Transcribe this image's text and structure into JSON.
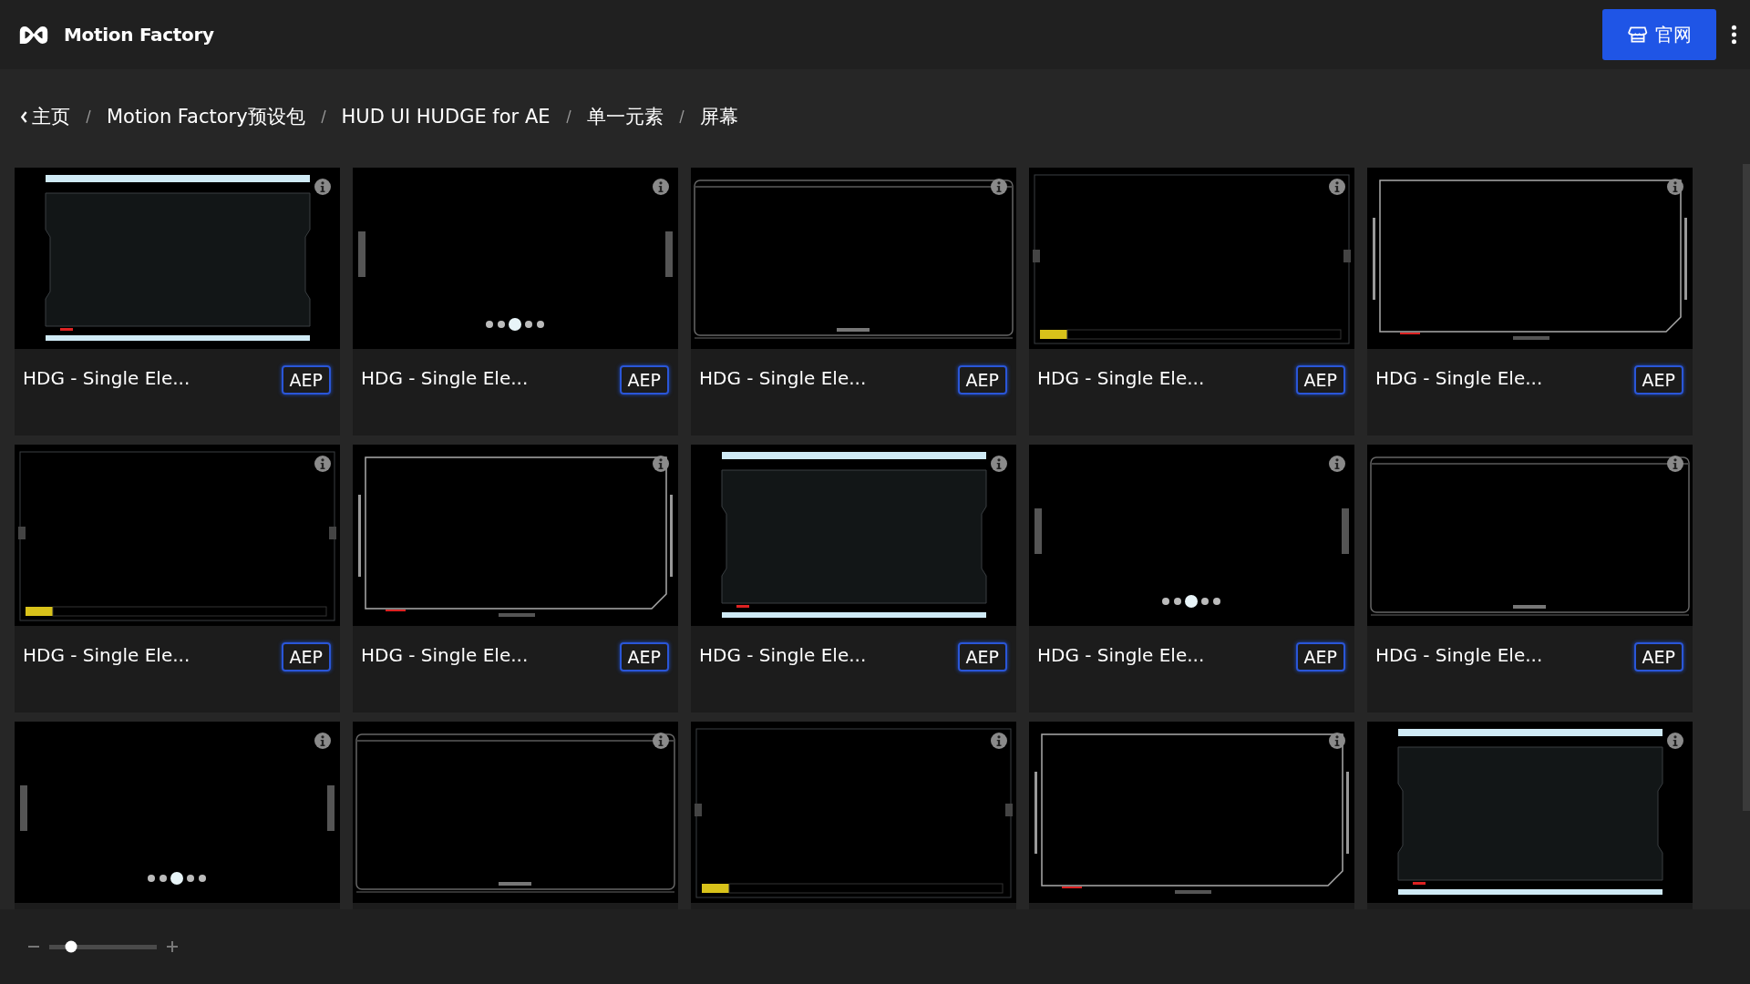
{
  "header": {
    "brand": "Motion Factory",
    "site_button": "官网"
  },
  "breadcrumb": [
    {
      "label": "主页",
      "kind": "back"
    },
    {
      "label": "Motion Factory预设包",
      "kind": "link"
    },
    {
      "label": "HUD UI HUDGE for AE",
      "kind": "link"
    },
    {
      "label": "单一元素",
      "kind": "link"
    },
    {
      "label": "屏幕",
      "kind": "current"
    }
  ],
  "cards": [
    {
      "title": "HDG - Single Ele...",
      "badge": "AEP",
      "kind": "picture"
    },
    {
      "title": "HDG - Single Ele...",
      "badge": "AEP",
      "kind": "picture"
    },
    {
      "title": "HDG - Single Ele...",
      "badge": "AEP",
      "kind": "picture"
    },
    {
      "title": "HDG - Single Ele...",
      "badge": "AEP",
      "kind": "picture"
    },
    {
      "title": "HDG - Single Ele...",
      "badge": "AEP",
      "kind": "picture"
    },
    {
      "title": "HDG - Single Ele...",
      "badge": "AEP",
      "kind": "picture"
    },
    {
      "title": "HDG - Single Ele...",
      "badge": "AEP",
      "kind": "picture"
    },
    {
      "title": "HDG - Single Ele...",
      "badge": "AEP",
      "kind": "picture"
    },
    {
      "title": "HDG - Single Ele...",
      "badge": "AEP",
      "kind": "picture"
    },
    {
      "title": "HDG - Single Ele...",
      "badge": "AEP",
      "kind": "picture"
    },
    {
      "kind": "picture"
    },
    {
      "kind": "picture"
    },
    {
      "kind": "picture"
    },
    {
      "kind": "picture"
    },
    {
      "kind": "picture"
    }
  ],
  "zoom_slider": {
    "level": 0.2
  }
}
